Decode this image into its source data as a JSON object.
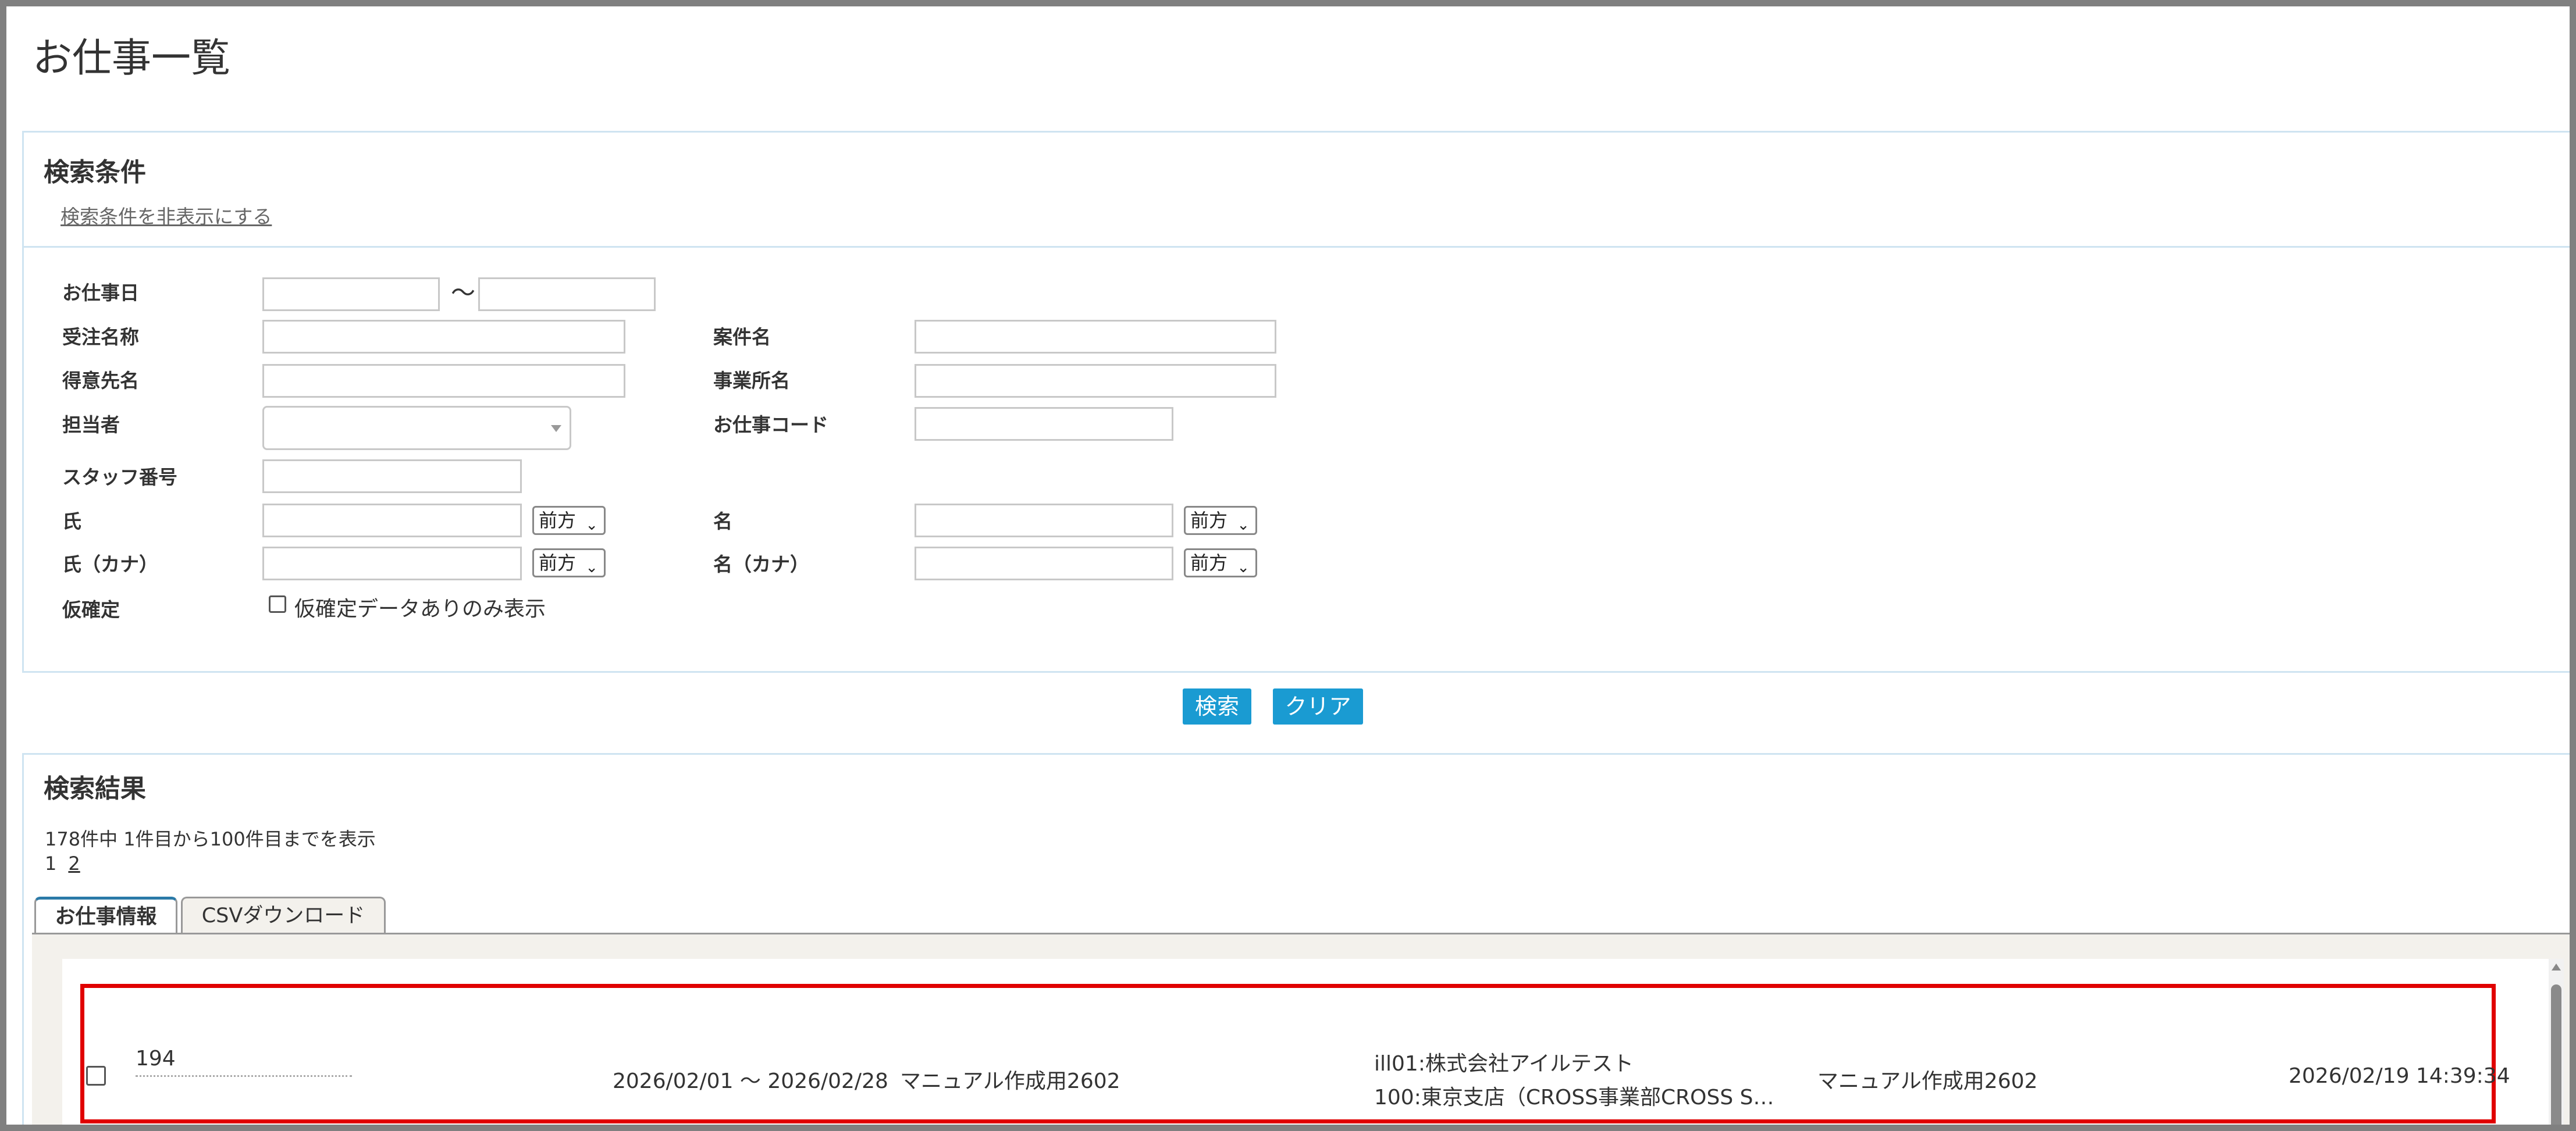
{
  "page": {
    "title": "お仕事一覧"
  },
  "search": {
    "title": "検索条件",
    "toggle_label": "検索条件を非表示にする",
    "fields": {
      "work_date": "お仕事日",
      "date_separator": "〜",
      "order_name": "受注名称",
      "project_name": "案件名",
      "customer_name": "得意先名",
      "office_name": "事業所名",
      "assignee": "担当者",
      "work_code": "お仕事コード",
      "staff_number": "スタッフ番号",
      "last_name": "氏",
      "first_name": "名",
      "last_name_kana": "氏（カナ）",
      "first_name_kana": "名（カナ）",
      "provisional": "仮確定",
      "provisional_checkbox_label": "仮確定データありのみ表示"
    },
    "match_mode": "前方",
    "search_button": "検索",
    "clear_button": "クリア"
  },
  "results": {
    "title": "検索結果",
    "count_text": "178件中 1件目から100件目までを表示",
    "pages": [
      "1",
      "2"
    ],
    "tabs": [
      "お仕事情報",
      "CSVダウンロード"
    ],
    "rows": [
      {
        "code": "194",
        "period": "2026/02/01 〜 2026/02/28",
        "order_name": "マニュアル作成用2602",
        "customer": "ill01:株式会社アイルテスト",
        "office": "100:東京支店（CROSS事業部CROSS S…",
        "project_name": "マニュアル作成用2602",
        "updated_at": "2026/02/19 14:39:34"
      }
    ]
  }
}
